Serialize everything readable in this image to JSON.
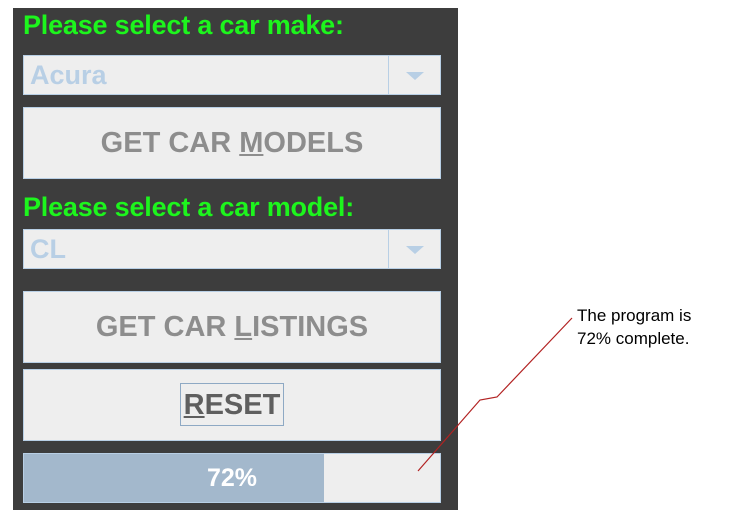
{
  "make_section": {
    "heading": "Please select a car make:",
    "selected": "Acura"
  },
  "get_models_button": {
    "before": "GET CAR ",
    "mnemonic": "M",
    "after": "ODELS"
  },
  "model_section": {
    "heading": "Please select a car model:",
    "selected": "CL"
  },
  "get_listings_button": {
    "before": "GET CAR ",
    "mnemonic": "L",
    "after": "ISTINGS"
  },
  "reset_button": {
    "mnemonic": "R",
    "after": "ESET"
  },
  "progress": {
    "value": 0.72,
    "label": "72%"
  },
  "annotation": {
    "line1": "The program is",
    "line2": "72% complete."
  },
  "colors": {
    "panel_background": "#3d3d3d",
    "heading_green": "#1df51d",
    "control_border": "#b8cfe5",
    "progress_fill": "#a3b8cc",
    "leader_line": "#b22222"
  }
}
